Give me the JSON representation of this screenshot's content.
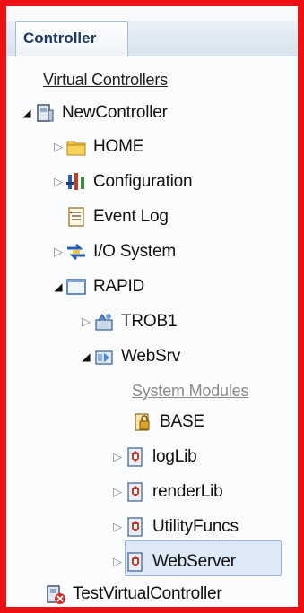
{
  "panel": {
    "tab_label": "Controller"
  },
  "tree": {
    "header_virtual": "Virtual Controllers",
    "controller": {
      "label": "NewController",
      "icon": "controller-icon"
    },
    "items": [
      {
        "label": "HOME",
        "icon": "folder-icon"
      },
      {
        "label": "Configuration",
        "icon": "configuration-icon"
      },
      {
        "label": "Event Log",
        "icon": "event-log-icon"
      },
      {
        "label": "I/O System",
        "icon": "io-system-icon"
      },
      {
        "label": "RAPID",
        "icon": "rapid-icon"
      },
      {
        "label": "TROB1",
        "icon": "task-icon"
      },
      {
        "label": "WebSrv",
        "icon": "task-icon"
      },
      {
        "label": "BASE",
        "icon": "module-lock-icon"
      },
      {
        "label": "logLib",
        "icon": "module-icon"
      },
      {
        "label": "renderLib",
        "icon": "module-icon"
      },
      {
        "label": "UtilityFuncs",
        "icon": "module-icon"
      },
      {
        "label": "WebServer",
        "icon": "module-icon"
      }
    ],
    "header_system_modules": "System Modules",
    "test_controller": {
      "label": "TestVirtualController",
      "icon": "controller-error-icon"
    }
  },
  "colors": {
    "frame_border": "#ee1111",
    "selection": "#dde9f7"
  }
}
